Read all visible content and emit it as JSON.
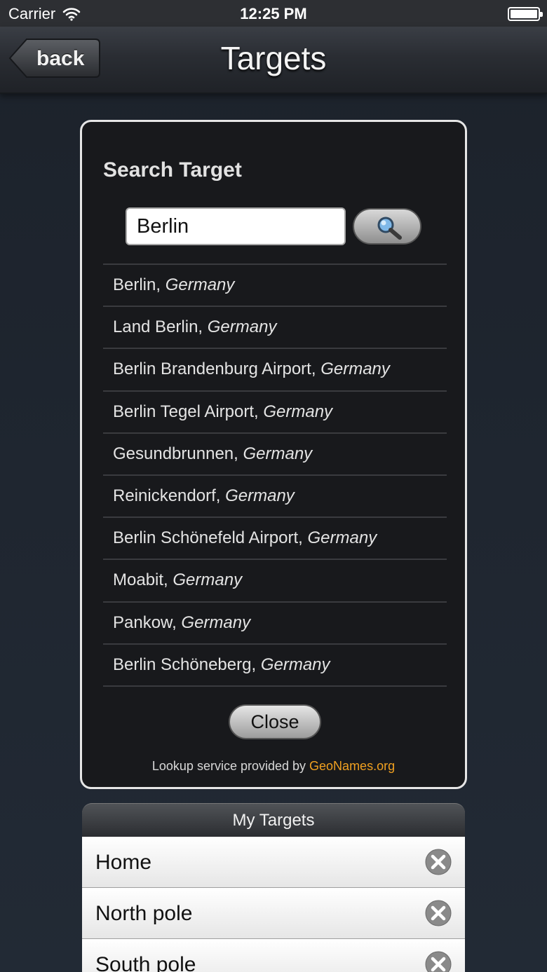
{
  "status_bar": {
    "carrier": "Carrier",
    "time": "12:25 PM"
  },
  "nav": {
    "back_label": "back",
    "title": "Targets"
  },
  "search": {
    "heading": "Search Target",
    "query": "Berlin",
    "results": [
      {
        "place": "Berlin",
        "country": "Germany"
      },
      {
        "place": "Land Berlin",
        "country": "Germany"
      },
      {
        "place": "Berlin Brandenburg Airport",
        "country": "Germany"
      },
      {
        "place": "Berlin Tegel Airport",
        "country": "Germany"
      },
      {
        "place": "Gesundbrunnen",
        "country": "Germany"
      },
      {
        "place": "Reinickendorf",
        "country": "Germany"
      },
      {
        "place": "Berlin Schönefeld Airport",
        "country": "Germany"
      },
      {
        "place": "Moabit",
        "country": "Germany"
      },
      {
        "place": "Pankow",
        "country": "Germany"
      },
      {
        "place": "Berlin Schöneberg",
        "country": "Germany"
      }
    ],
    "close_label": "Close",
    "credit_prefix": "Lookup service provided by ",
    "credit_link": "GeoNames.org"
  },
  "my_targets": {
    "header": "My Targets",
    "items": [
      {
        "label": "Home"
      },
      {
        "label": "North pole"
      },
      {
        "label": "South pole"
      }
    ]
  },
  "colors": {
    "link": "#f0a020",
    "panel_border": "#e6e6e6",
    "background": "#1f252e"
  },
  "icons": {
    "wifi": "wifi-icon",
    "battery": "battery-icon",
    "search": "magnifier-icon",
    "delete": "delete-icon"
  }
}
